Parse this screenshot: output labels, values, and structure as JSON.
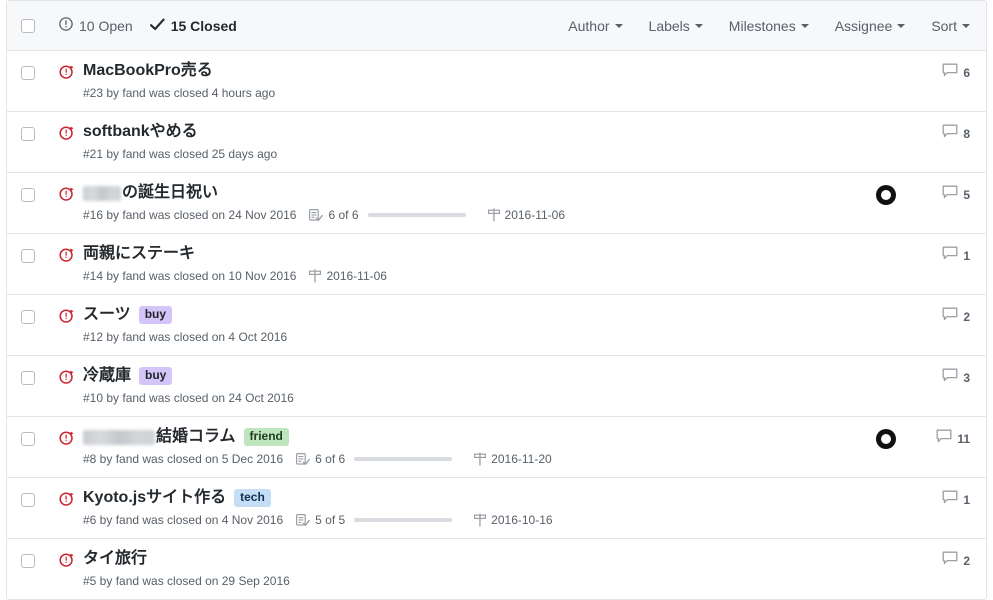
{
  "header": {
    "select_all_checkbox": "select-all",
    "open_count_label": "10 Open",
    "closed_count_label": "15 Closed",
    "open_icon": "issue-opened-icon",
    "closed_icon": "check-icon",
    "filters": [
      {
        "label": "Author"
      },
      {
        "label": "Labels"
      },
      {
        "label": "Milestones"
      },
      {
        "label": "Assignee"
      },
      {
        "label": "Sort"
      }
    ]
  },
  "colors": {
    "header_bg": "#f6f8fa",
    "border": "#e1e4e8",
    "closed_icon": "#cb2431",
    "muted_text": "#586069",
    "title_text": "#24292e",
    "label_buy_bg": "#d4c5f9",
    "label_buy_text": "#1f2328",
    "label_friend_bg": "#bfe5bf",
    "label_friend_text": "#1f3d20",
    "label_tech_bg": "#c5def5",
    "label_tech_text": "#12304d"
  },
  "issues": [
    {
      "state_icon": "issue-closed-icon",
      "title": "MacBookPro売る",
      "redacted_width": 0,
      "labels": [],
      "meta": "#23 by fand was closed 4 hours ago",
      "tasks": null,
      "progress": null,
      "milestone": null,
      "assignee": false,
      "comments": "6"
    },
    {
      "state_icon": "issue-closed-icon",
      "title": "softbankやめる",
      "redacted_width": 0,
      "labels": [],
      "meta": "#21 by fand was closed 25 days ago",
      "tasks": null,
      "progress": null,
      "milestone": null,
      "assignee": false,
      "comments": "8"
    },
    {
      "state_icon": "issue-closed-icon",
      "title": "の誕生日祝い",
      "redacted_width": 38,
      "labels": [],
      "meta": "#16 by fand was closed on 24 Nov 2016",
      "tasks": "6 of 6",
      "progress": 100,
      "milestone": "2016-11-06",
      "assignee": true,
      "comments": "5"
    },
    {
      "state_icon": "issue-closed-icon",
      "title": "両親にステーキ",
      "redacted_width": 0,
      "labels": [],
      "meta": "#14 by fand was closed on 10 Nov 2016",
      "tasks": null,
      "progress": null,
      "milestone": "2016-11-06",
      "assignee": false,
      "comments": "1"
    },
    {
      "state_icon": "issue-closed-icon",
      "title": "スーツ",
      "redacted_width": 0,
      "labels": [
        {
          "text": "buy",
          "style": "buy"
        }
      ],
      "meta": "#12 by fand was closed on 4 Oct 2016",
      "tasks": null,
      "progress": null,
      "milestone": null,
      "assignee": false,
      "comments": "2"
    },
    {
      "state_icon": "issue-closed-icon",
      "title": "冷蔵庫",
      "redacted_width": 0,
      "labels": [
        {
          "text": "buy",
          "style": "buy"
        }
      ],
      "meta": "#10 by fand was closed on 24 Oct 2016",
      "tasks": null,
      "progress": null,
      "milestone": null,
      "assignee": false,
      "comments": "3"
    },
    {
      "state_icon": "issue-closed-icon",
      "title": "結婚コラム",
      "redacted_width": 72,
      "labels": [
        {
          "text": "friend",
          "style": "friend"
        }
      ],
      "meta": "#8 by fand was closed on 5 Dec 2016",
      "tasks": "6 of 6",
      "progress": 100,
      "milestone": "2016-11-20",
      "assignee": true,
      "comments": "11"
    },
    {
      "state_icon": "issue-closed-icon",
      "title": "Kyoto.jsサイト作る",
      "redacted_width": 0,
      "labels": [
        {
          "text": "tech",
          "style": "tech"
        }
      ],
      "meta": "#6 by fand was closed on 4 Nov 2016",
      "tasks": "5 of 5",
      "progress": 100,
      "milestone": "2016-10-16",
      "assignee": false,
      "comments": "1"
    },
    {
      "state_icon": "issue-closed-icon",
      "title": "タイ旅行",
      "redacted_width": 0,
      "labels": [],
      "meta": "#5 by fand was closed on 29 Sep 2016",
      "tasks": null,
      "progress": null,
      "milestone": null,
      "assignee": false,
      "comments": "2"
    }
  ]
}
